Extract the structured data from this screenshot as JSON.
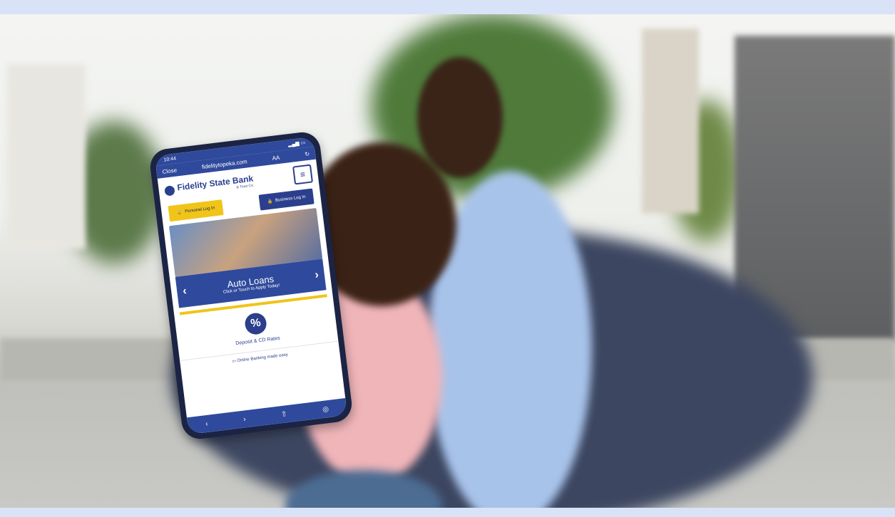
{
  "colors": {
    "frame": "#d8e3f7",
    "bank_blue": "#2f4a9c",
    "bank_gold": "#f0c419"
  },
  "phone": {
    "time": "10:44",
    "close": "Close",
    "url": "fidelitytopeka.com",
    "text_size": "AA",
    "reload_icon": "reload-icon",
    "bank_name": "Fidelity State Bank",
    "bank_name_sub": "& Trust Co.",
    "menu_icon": "hamburger-menu-icon",
    "personal_login": "Personal Log In",
    "business_login": "Business Log In",
    "hero_title": "Auto Loans",
    "hero_sub": "Click or Touch to Apply Today!",
    "rates_symbol": "%",
    "rates_label": "Deposit & CD Rates",
    "online_banking": "Online Banking made easy"
  }
}
